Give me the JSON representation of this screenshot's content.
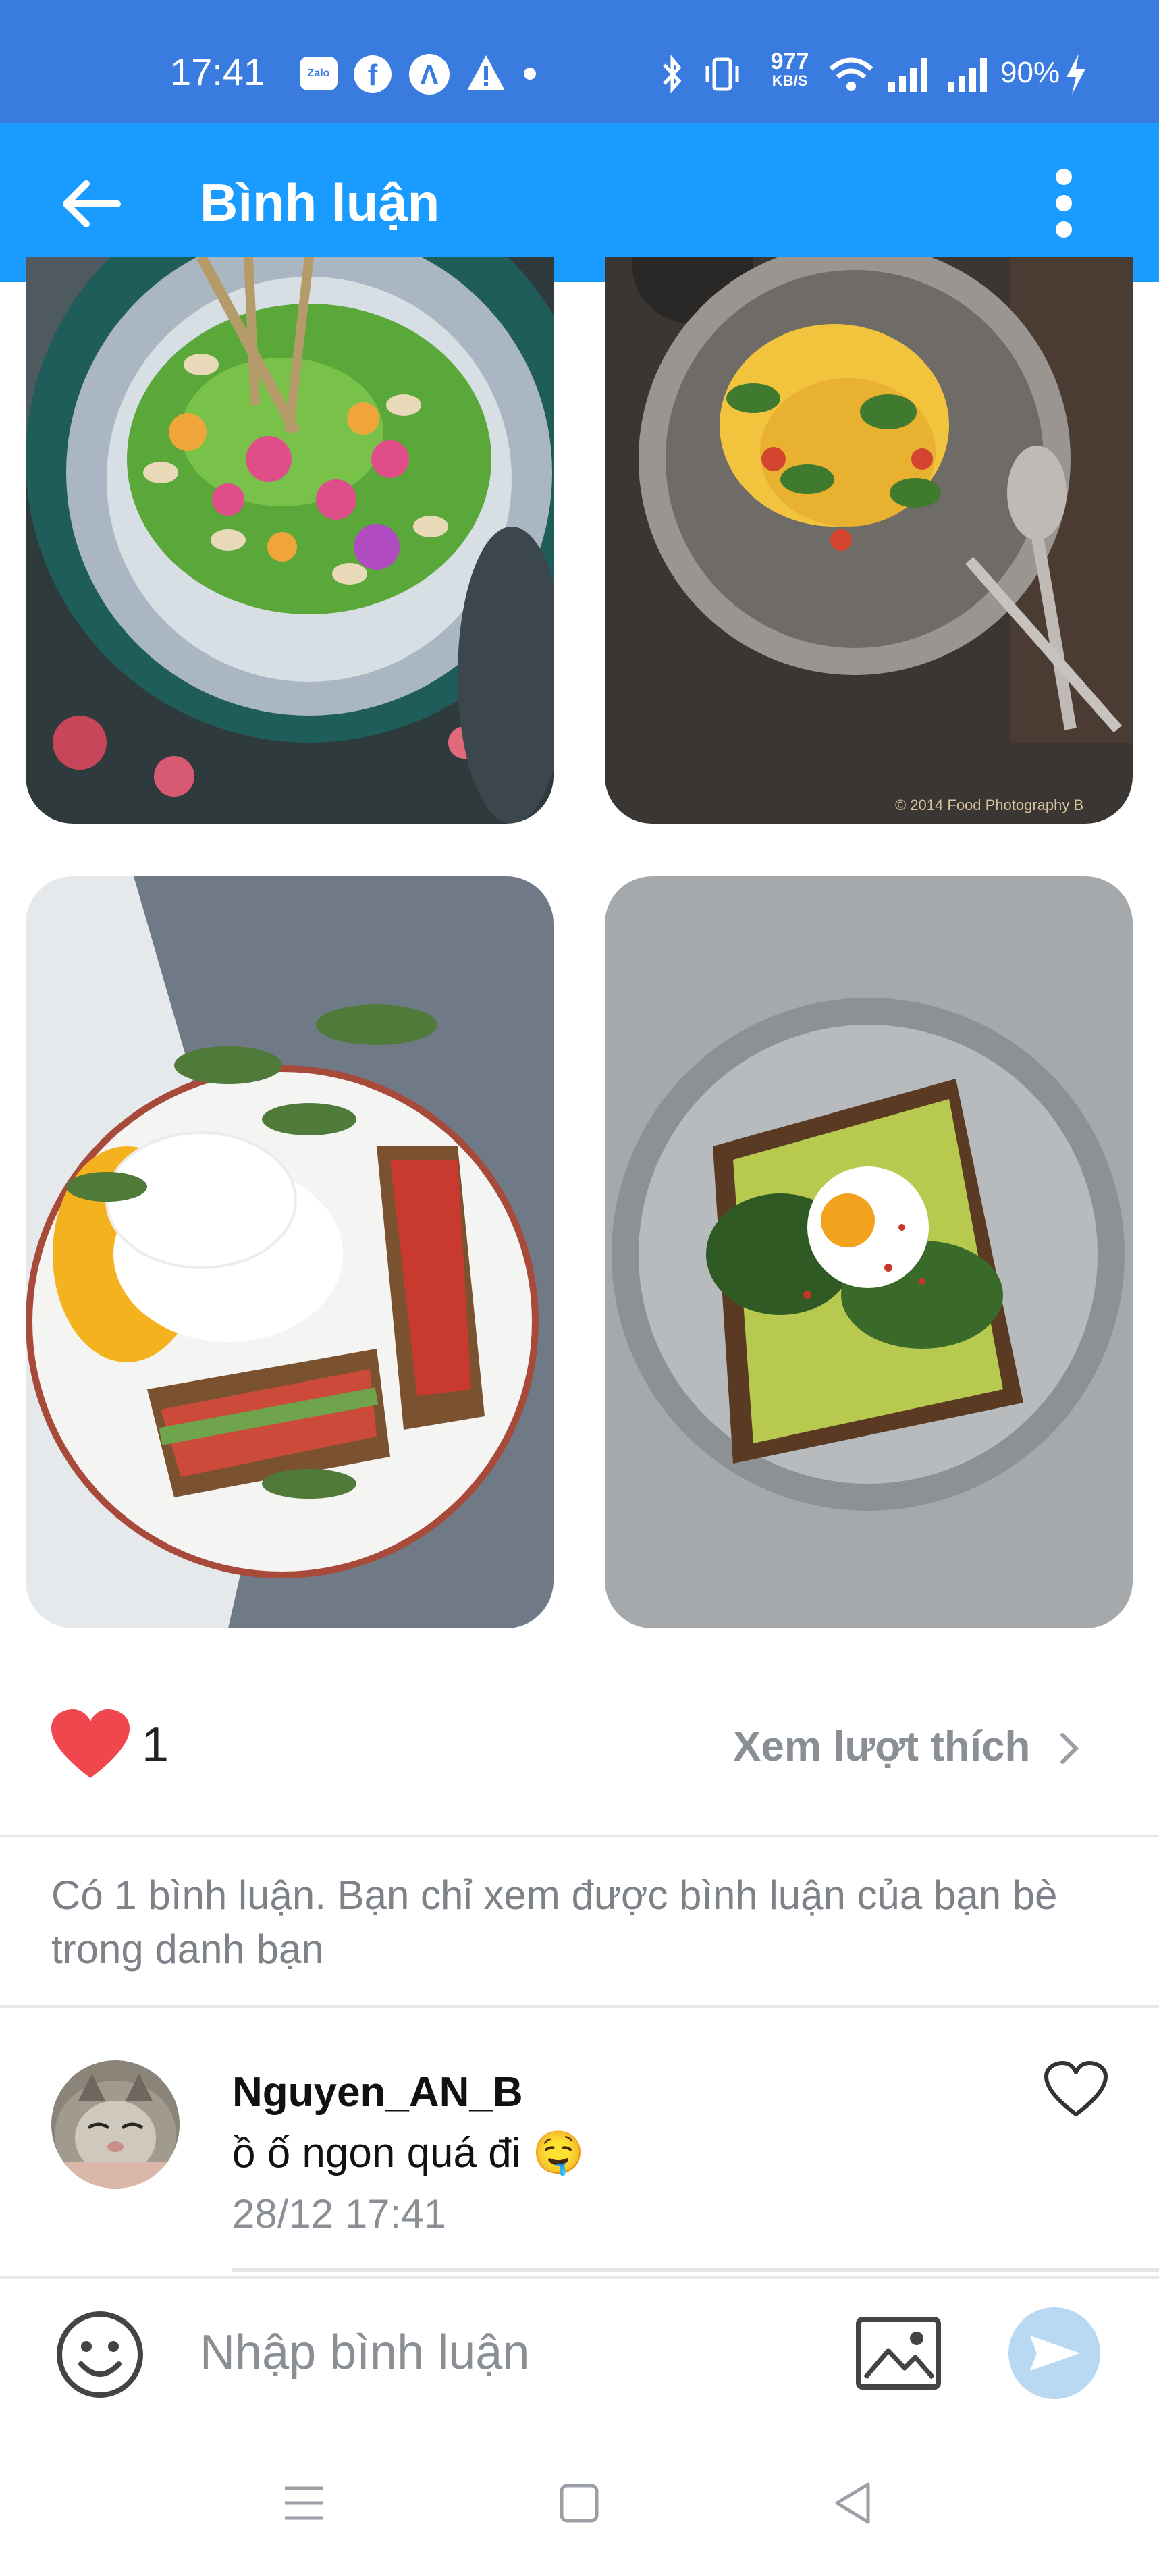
{
  "status_bar": {
    "time": "17:41",
    "speed_value": "977",
    "speed_unit": "KB/S",
    "battery_pct": "90%",
    "notification_icons": [
      "zalo-icon",
      "facebook-icon",
      "navigation-app-icon",
      "warning-icon",
      "dot-icon"
    ],
    "system_icons": [
      "bluetooth-icon",
      "vibrate-icon",
      "wifi-icon",
      "signal-icon",
      "signal-icon",
      "charging-icon"
    ]
  },
  "app_bar": {
    "title": "Bình luận",
    "back_icon": "arrow-left-icon",
    "menu_icon": "more-vertical-icon"
  },
  "photos": {
    "items": [
      {
        "name": "photo-hummus-bowl",
        "icon": "image"
      },
      {
        "name": "photo-pasta-plate",
        "icon": "image",
        "watermark": "© 2014 Food Photography B"
      },
      {
        "name": "photo-egg-toast-plate",
        "icon": "image"
      },
      {
        "name": "photo-avocado-egg-toast",
        "icon": "image"
      }
    ]
  },
  "likes": {
    "count": "1",
    "view_likes_label": "Xem lượt thích"
  },
  "comments_notice": "Có 1 bình luận. Bạn chỉ xem được bình luận của bạn bè trong danh bạn",
  "comments": [
    {
      "user": "Nguyen_AN_B",
      "text": "ồ ố ngon quá đi 🤤",
      "date": "28/12 17:41"
    }
  ],
  "input": {
    "placeholder": "Nhập bình luận"
  },
  "colors": {
    "status_bar": "#3a7be0",
    "app_bar": "#1a9bff",
    "heart": "#f0464e",
    "send_button": "#b9d8f2"
  }
}
